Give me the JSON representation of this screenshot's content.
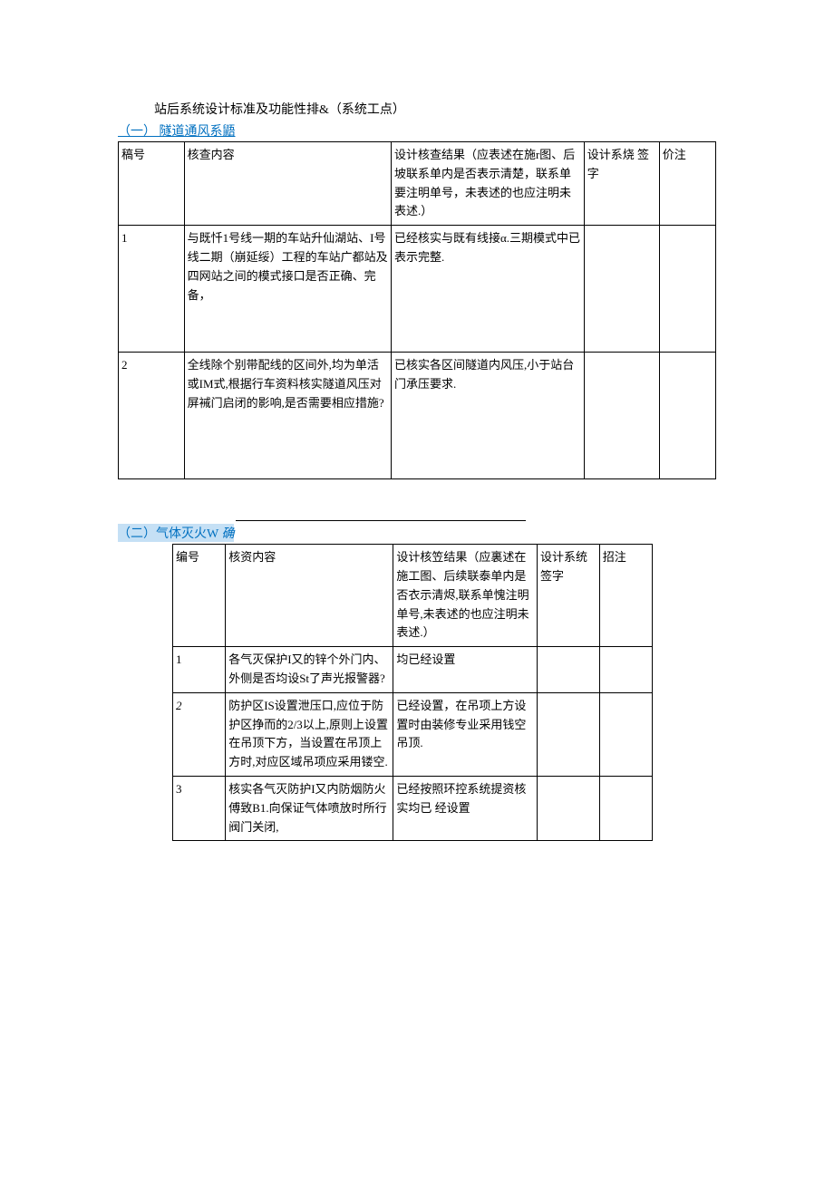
{
  "doc_title": "站后系统设计标准及功能性排&（系统工点）",
  "section1": {
    "heading": "（一） 隧道通风系鼯",
    "headers": {
      "col1": "稿号",
      "col2": "核查内容",
      "col3": "设计核查结果（应表述在施r图、后坡联系单内是否表示清楚，联系单要注明单号，未表述的也应注明未表述.）",
      "col4": "设计系烧 签字",
      "col5": "价注"
    },
    "rows": [
      {
        "num": "1",
        "content": "与既忏1号线一期的车站升仙湖站、I号线二期（崩延绥）工程的车站广都站及四网站之间的模式接口是否正确、完备，",
        "result": "已经核实与既有线接α.三期模式中已表示完整.",
        "sign": "",
        "note": ""
      },
      {
        "num": "2",
        "content": "全线除个别带配线的区间外,均为单活或IM式,根据行车资料核实隧道风压对屏裓门启闭的影响,是否需要相应措施?",
        "result": "已核实各区间隧道内风压,小于站台门承压要求.",
        "sign": "",
        "note": ""
      }
    ]
  },
  "section2": {
    "heading_prefix": "（二）气体灭火W",
    "heading_suffix": "确",
    "headers": {
      "col1": "编号",
      "col2": "核资内容",
      "col3": "设计核笠结果（应裏述在施工图、后续联泰单内是否衣示清烬,联系单愧注明单号,未表述的也应注明未表述.）",
      "col4": "设计系统 签字",
      "col5": "招注"
    },
    "rows": [
      {
        "num": "1",
        "content": "各气灭保护I又的锌个外门内、外侧是否均设St了声光报警器?",
        "result": "均已经设置",
        "sign": "",
        "note": ""
      },
      {
        "num": "2",
        "content": "防护区IS设置泄压口,应位于防护区挣而的2/3以上,原则上设置在吊顶下方，当设置在吊顶上方时,对应区域吊项应采用镂空.",
        "result": "已经设置，在吊项上方设置时由装修专业采用钱空吊顶.",
        "sign": "",
        "note": ""
      },
      {
        "num": "3",
        "content": "核实各气灭防护I又内防烟防火傅致B1.向保证气体喷放时所行阀门关闭,",
        "result": "已经按照环控系统提资核实均已 经设置",
        "sign": "",
        "note": ""
      }
    ]
  }
}
